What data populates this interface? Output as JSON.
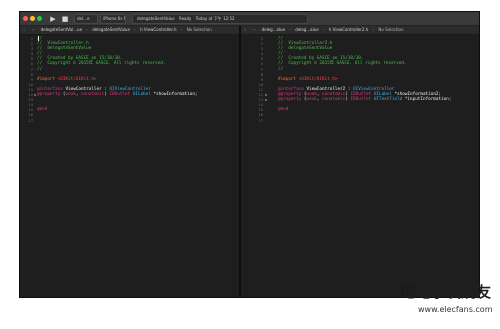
{
  "toolbar": {
    "run_icon": "play-icon",
    "stop_icon": "stop-icon",
    "scheme": "del…e",
    "device": "iPhone 6s Plus",
    "status": {
      "project": "delegateSentValue",
      "state": "Ready",
      "today_label": "Today at 下午 12:52"
    }
  },
  "left_pane": {
    "jumpbar": {
      "nav_back": "‹",
      "nav_forward": "›",
      "file": "delegateSentVal...ue",
      "sep1": "›",
      "crumb2": "delegateSentValue",
      "sep2": "›",
      "crumb3": "h ViewController.h",
      "sep3": "›",
      "selection": "No Selection"
    },
    "line_numbers": [
      "1",
      "2",
      "3",
      "4",
      "5",
      "6",
      "7",
      "8",
      "9",
      "10",
      "11",
      "12",
      "13",
      "14",
      "15",
      "16",
      "17"
    ],
    "lines": [
      [
        {
          "t": "//",
          "c": "comment"
        }
      ],
      [
        {
          "t": "//  ViewController.h",
          "c": "comment"
        }
      ],
      [
        {
          "t": "//  delegateSentValue",
          "c": "comment"
        }
      ],
      [
        {
          "t": "//",
          "c": "comment"
        }
      ],
      [
        {
          "t": "//  Created by GASCE on 15/10/30.",
          "c": "comment"
        }
      ],
      [
        {
          "t": "//  Copyright © 2015年 GASCE. All rights reserved.",
          "c": "comment"
        }
      ],
      [
        {
          "t": "//",
          "c": "comment"
        }
      ],
      [
        {
          "t": "",
          "c": "plain"
        }
      ],
      [
        {
          "t": "#import ",
          "c": "preproc"
        },
        {
          "t": "<UIKit/UIKit.h>",
          "c": "string"
        }
      ],
      [
        {
          "t": "",
          "c": "plain"
        }
      ],
      [
        {
          "t": "@interface",
          "c": "keyword"
        },
        {
          "t": " ViewController : ",
          "c": "plain"
        },
        {
          "t": "UIViewController",
          "c": "class"
        }
      ],
      [
        {
          "t": "@property",
          "c": "keyword"
        },
        {
          "t": " (",
          "c": "plain"
        },
        {
          "t": "weak",
          "c": "keyword"
        },
        {
          "t": ", ",
          "c": "plain"
        },
        {
          "t": "nonatomic",
          "c": "keyword"
        },
        {
          "t": ") ",
          "c": "plain"
        },
        {
          "t": "IBOutlet",
          "c": "keyword"
        },
        {
          "t": " ",
          "c": "plain"
        },
        {
          "t": "UILabel",
          "c": "class"
        },
        {
          "t": " *showInformation;",
          "c": "plain"
        }
      ],
      [
        {
          "t": "",
          "c": "plain"
        }
      ],
      [
        {
          "t": "",
          "c": "plain"
        }
      ],
      [
        {
          "t": "@end",
          "c": "keyword"
        }
      ],
      [
        {
          "t": "",
          "c": "plain"
        }
      ],
      [
        {
          "t": "",
          "c": "plain"
        }
      ]
    ]
  },
  "right_pane": {
    "jumpbar": {
      "nav_back": "‹",
      "nav_forward": "›",
      "file": "deleg...alue",
      "sep1": "›",
      "crumb2": "deleg...alue",
      "sep2": "›",
      "crumb3": "h ViewController2.h",
      "sep3": "›",
      "selection": "No Selection"
    },
    "line_numbers": [
      "1",
      "2",
      "3",
      "4",
      "5",
      "6",
      "7",
      "8",
      "9",
      "10",
      "11",
      "12",
      "13",
      "14",
      "15",
      "16",
      "17"
    ],
    "lines": [
      [
        {
          "t": "//",
          "c": "comment"
        }
      ],
      [
        {
          "t": "//  ViewController2.h",
          "c": "comment"
        }
      ],
      [
        {
          "t": "//  delegateSentValue",
          "c": "comment"
        }
      ],
      [
        {
          "t": "//",
          "c": "comment"
        }
      ],
      [
        {
          "t": "//  Created by GASCE on 15/10/30.",
          "c": "comment"
        }
      ],
      [
        {
          "t": "//  Copyright © 2015年 GASCE. All rights reserved.",
          "c": "comment"
        }
      ],
      [
        {
          "t": "//",
          "c": "comment"
        }
      ],
      [
        {
          "t": "",
          "c": "plain"
        }
      ],
      [
        {
          "t": "#import ",
          "c": "preproc"
        },
        {
          "t": "<UIKit/UIKit.h>",
          "c": "string"
        }
      ],
      [
        {
          "t": "",
          "c": "plain"
        }
      ],
      [
        {
          "t": "@interface",
          "c": "keyword"
        },
        {
          "t": " ViewController2 : ",
          "c": "plain"
        },
        {
          "t": "UIViewController",
          "c": "class"
        }
      ],
      [
        {
          "t": "@property",
          "c": "keyword"
        },
        {
          "t": " (",
          "c": "plain"
        },
        {
          "t": "weak",
          "c": "keyword"
        },
        {
          "t": ", ",
          "c": "plain"
        },
        {
          "t": "nonatomic",
          "c": "keyword"
        },
        {
          "t": ") ",
          "c": "plain"
        },
        {
          "t": "IBOutlet",
          "c": "keyword"
        },
        {
          "t": " ",
          "c": "plain"
        },
        {
          "t": "UILabel",
          "c": "class"
        },
        {
          "t": " *showInformation2;",
          "c": "plain"
        }
      ],
      [
        {
          "t": "@property",
          "c": "keyword"
        },
        {
          "t": " (",
          "c": "plain"
        },
        {
          "t": "weak",
          "c": "keyword"
        },
        {
          "t": ", ",
          "c": "plain"
        },
        {
          "t": "nonatomic",
          "c": "keyword"
        },
        {
          "t": ") ",
          "c": "plain"
        },
        {
          "t": "IBOutlet",
          "c": "keyword"
        },
        {
          "t": " ",
          "c": "plain"
        },
        {
          "t": "UITextField",
          "c": "class"
        },
        {
          "t": " *inputInformation;",
          "c": "plain"
        }
      ],
      [
        {
          "t": "",
          "c": "plain"
        }
      ],
      [
        {
          "t": "@end",
          "c": "keyword"
        }
      ],
      [
        {
          "t": "",
          "c": "plain"
        }
      ],
      [
        {
          "t": "",
          "c": "plain"
        }
      ]
    ]
  },
  "watermark": {
    "logo_glyph": "电",
    "title": "电子发烧友",
    "url": "www.elecfans.com"
  },
  "colors": {
    "comment": "#4cbf52",
    "preproc": "#e2703c",
    "string": "#f2414e",
    "keyword": "#d6367e",
    "class": "#3fb0e8",
    "background": "#1e1e1e"
  }
}
